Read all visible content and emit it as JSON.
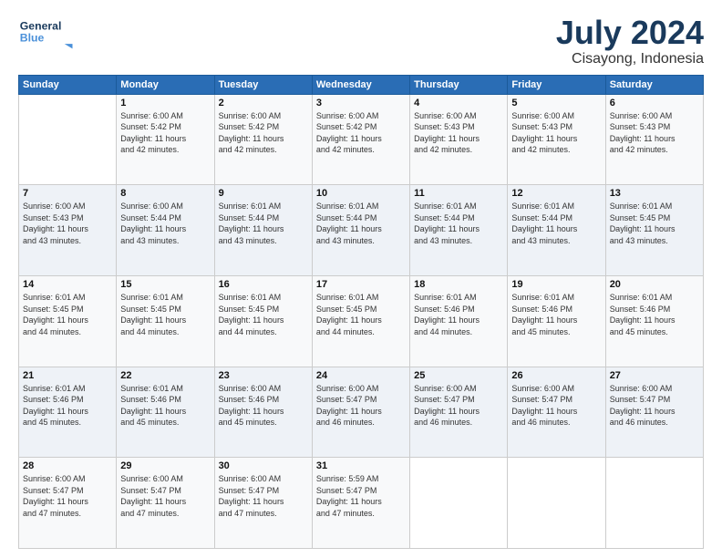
{
  "logo": {
    "line1": "General",
    "line2": "Blue",
    "arrow": "▶"
  },
  "header": {
    "month": "July 2024",
    "location": "Cisayong, Indonesia"
  },
  "weekdays": [
    "Sunday",
    "Monday",
    "Tuesday",
    "Wednesday",
    "Thursday",
    "Friday",
    "Saturday"
  ],
  "weeks": [
    [
      {
        "day": "",
        "info": ""
      },
      {
        "day": "1",
        "info": "Sunrise: 6:00 AM\nSunset: 5:42 PM\nDaylight: 11 hours\nand 42 minutes."
      },
      {
        "day": "2",
        "info": "Sunrise: 6:00 AM\nSunset: 5:42 PM\nDaylight: 11 hours\nand 42 minutes."
      },
      {
        "day": "3",
        "info": "Sunrise: 6:00 AM\nSunset: 5:42 PM\nDaylight: 11 hours\nand 42 minutes."
      },
      {
        "day": "4",
        "info": "Sunrise: 6:00 AM\nSunset: 5:43 PM\nDaylight: 11 hours\nand 42 minutes."
      },
      {
        "day": "5",
        "info": "Sunrise: 6:00 AM\nSunset: 5:43 PM\nDaylight: 11 hours\nand 42 minutes."
      },
      {
        "day": "6",
        "info": "Sunrise: 6:00 AM\nSunset: 5:43 PM\nDaylight: 11 hours\nand 42 minutes."
      }
    ],
    [
      {
        "day": "7",
        "info": "Sunrise: 6:00 AM\nSunset: 5:43 PM\nDaylight: 11 hours\nand 43 minutes."
      },
      {
        "day": "8",
        "info": "Sunrise: 6:00 AM\nSunset: 5:44 PM\nDaylight: 11 hours\nand 43 minutes."
      },
      {
        "day": "9",
        "info": "Sunrise: 6:01 AM\nSunset: 5:44 PM\nDaylight: 11 hours\nand 43 minutes."
      },
      {
        "day": "10",
        "info": "Sunrise: 6:01 AM\nSunset: 5:44 PM\nDaylight: 11 hours\nand 43 minutes."
      },
      {
        "day": "11",
        "info": "Sunrise: 6:01 AM\nSunset: 5:44 PM\nDaylight: 11 hours\nand 43 minutes."
      },
      {
        "day": "12",
        "info": "Sunrise: 6:01 AM\nSunset: 5:44 PM\nDaylight: 11 hours\nand 43 minutes."
      },
      {
        "day": "13",
        "info": "Sunrise: 6:01 AM\nSunset: 5:45 PM\nDaylight: 11 hours\nand 43 minutes."
      }
    ],
    [
      {
        "day": "14",
        "info": "Sunrise: 6:01 AM\nSunset: 5:45 PM\nDaylight: 11 hours\nand 44 minutes."
      },
      {
        "day": "15",
        "info": "Sunrise: 6:01 AM\nSunset: 5:45 PM\nDaylight: 11 hours\nand 44 minutes."
      },
      {
        "day": "16",
        "info": "Sunrise: 6:01 AM\nSunset: 5:45 PM\nDaylight: 11 hours\nand 44 minutes."
      },
      {
        "day": "17",
        "info": "Sunrise: 6:01 AM\nSunset: 5:45 PM\nDaylight: 11 hours\nand 44 minutes."
      },
      {
        "day": "18",
        "info": "Sunrise: 6:01 AM\nSunset: 5:46 PM\nDaylight: 11 hours\nand 44 minutes."
      },
      {
        "day": "19",
        "info": "Sunrise: 6:01 AM\nSunset: 5:46 PM\nDaylight: 11 hours\nand 45 minutes."
      },
      {
        "day": "20",
        "info": "Sunrise: 6:01 AM\nSunset: 5:46 PM\nDaylight: 11 hours\nand 45 minutes."
      }
    ],
    [
      {
        "day": "21",
        "info": "Sunrise: 6:01 AM\nSunset: 5:46 PM\nDaylight: 11 hours\nand 45 minutes."
      },
      {
        "day": "22",
        "info": "Sunrise: 6:01 AM\nSunset: 5:46 PM\nDaylight: 11 hours\nand 45 minutes."
      },
      {
        "day": "23",
        "info": "Sunrise: 6:00 AM\nSunset: 5:46 PM\nDaylight: 11 hours\nand 45 minutes."
      },
      {
        "day": "24",
        "info": "Sunrise: 6:00 AM\nSunset: 5:47 PM\nDaylight: 11 hours\nand 46 minutes."
      },
      {
        "day": "25",
        "info": "Sunrise: 6:00 AM\nSunset: 5:47 PM\nDaylight: 11 hours\nand 46 minutes."
      },
      {
        "day": "26",
        "info": "Sunrise: 6:00 AM\nSunset: 5:47 PM\nDaylight: 11 hours\nand 46 minutes."
      },
      {
        "day": "27",
        "info": "Sunrise: 6:00 AM\nSunset: 5:47 PM\nDaylight: 11 hours\nand 46 minutes."
      }
    ],
    [
      {
        "day": "28",
        "info": "Sunrise: 6:00 AM\nSunset: 5:47 PM\nDaylight: 11 hours\nand 47 minutes."
      },
      {
        "day": "29",
        "info": "Sunrise: 6:00 AM\nSunset: 5:47 PM\nDaylight: 11 hours\nand 47 minutes."
      },
      {
        "day": "30",
        "info": "Sunrise: 6:00 AM\nSunset: 5:47 PM\nDaylight: 11 hours\nand 47 minutes."
      },
      {
        "day": "31",
        "info": "Sunrise: 5:59 AM\nSunset: 5:47 PM\nDaylight: 11 hours\nand 47 minutes."
      },
      {
        "day": "",
        "info": ""
      },
      {
        "day": "",
        "info": ""
      },
      {
        "day": "",
        "info": ""
      }
    ]
  ]
}
